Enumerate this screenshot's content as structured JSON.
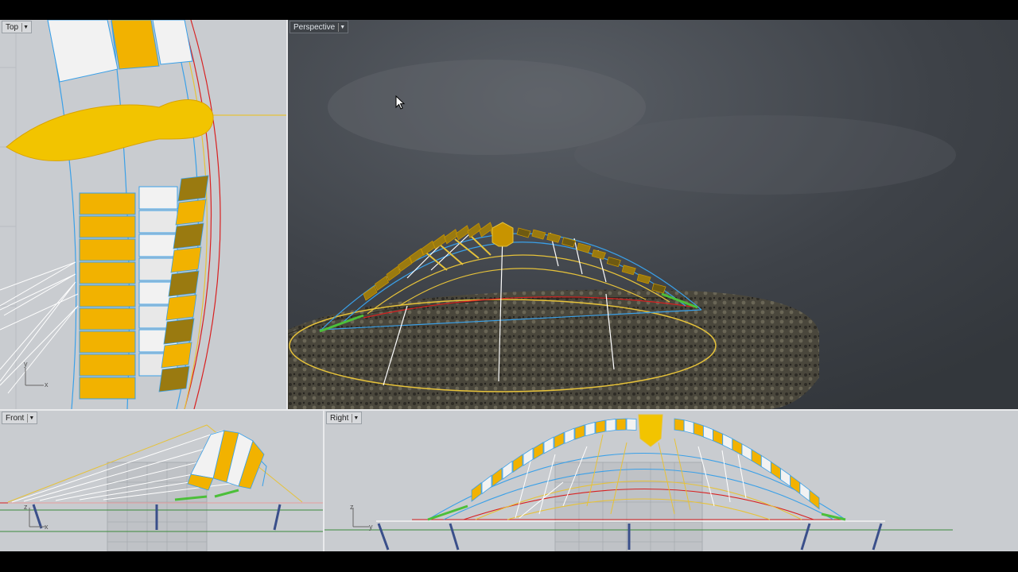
{
  "viewports": {
    "top": {
      "label": "Top",
      "axes": {
        "x": "x",
        "y": "y"
      }
    },
    "perspective": {
      "label": "Perspective"
    },
    "front": {
      "label": "Front",
      "axes": {
        "x": "x",
        "y": "z"
      }
    },
    "right": {
      "label": "Right",
      "axes": {
        "x": "y",
        "y": "z"
      }
    }
  },
  "colors": {
    "panel_yellow": "#f2b200",
    "panel_white": "#f2f2f2",
    "panel_dark": "#9a7a10",
    "curve_blue": "#3aa0e8",
    "curve_red": "#d82020",
    "curve_yellow": "#e6c23a",
    "cable_white": "#ffffff",
    "grid_green": "#3b8a3b",
    "viewport_bg": "#c9ccd0",
    "sky": "#3f4348"
  },
  "icons": {
    "dropdown": "chevron-down-icon",
    "cursor": "mouse-pointer-icon"
  }
}
